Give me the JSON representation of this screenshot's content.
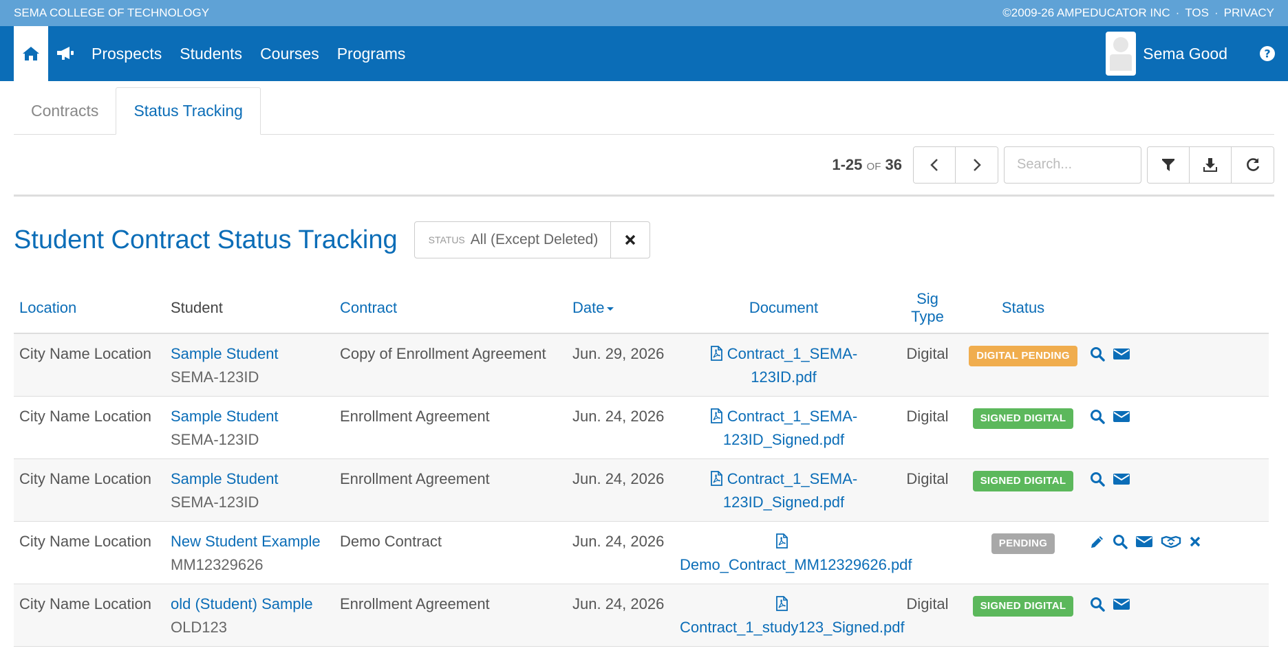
{
  "topbar": {
    "school": "SEMA COLLEGE OF TECHNOLOGY",
    "copyright": "©2009-26 AMPEDUCATOR INC",
    "tos": "TOS",
    "privacy": "PRIVACY",
    "sep": "·"
  },
  "nav": {
    "items": [
      {
        "label": "Prospects"
      },
      {
        "label": "Students"
      },
      {
        "label": "Courses"
      },
      {
        "label": "Programs"
      }
    ],
    "user_name": "Sema Good"
  },
  "tabs": [
    {
      "label": "Contracts",
      "active": false
    },
    {
      "label": "Status Tracking",
      "active": true
    }
  ],
  "toolbar": {
    "range": "1-25",
    "of": "of",
    "total": "36",
    "search_placeholder": "Search..."
  },
  "page": {
    "title": "Student Contract Status Tracking",
    "filter_label": "Status",
    "filter_value": "All (Except Deleted)"
  },
  "table": {
    "headers": {
      "location": "Location",
      "student": "Student",
      "contract": "Contract",
      "date": "Date",
      "document": "Document",
      "sig_type": "Sig Type",
      "status": "Status"
    },
    "rows": [
      {
        "location": "City Name Location",
        "student_name": "Sample Student",
        "student_id": "SEMA-123ID",
        "contract": "Copy of Enrollment Agreement",
        "date": "Jun. 29, 2026",
        "document": "Contract_1_SEMA-123ID.pdf",
        "sig_type": "Digital",
        "status": "DIGITAL PENDING",
        "status_color": "#f0ad4e",
        "actions": [
          "search",
          "envelope"
        ]
      },
      {
        "location": "City Name Location",
        "student_name": "Sample Student",
        "student_id": "SEMA-123ID",
        "contract": "Enrollment Agreement",
        "date": "Jun. 24, 2026",
        "document": "Contract_1_SEMA-123ID_Signed.pdf",
        "sig_type": "Digital",
        "status": "SIGNED DIGITAL",
        "status_color": "#5cb85c",
        "actions": [
          "search",
          "envelope"
        ]
      },
      {
        "location": "City Name Location",
        "student_name": "Sample Student",
        "student_id": "SEMA-123ID",
        "contract": "Enrollment Agreement",
        "date": "Jun. 24, 2026",
        "document": "Contract_1_SEMA-123ID_Signed.pdf",
        "sig_type": "Digital",
        "status": "SIGNED DIGITAL",
        "status_color": "#5cb85c",
        "actions": [
          "search",
          "envelope"
        ]
      },
      {
        "location": "City Name Location",
        "student_name": "New Student Example",
        "student_id": "MM12329626",
        "contract": "Demo Contract",
        "date": "Jun. 24, 2026",
        "document": "Demo_Contract_MM12329626.pdf",
        "sig_type": "",
        "status": "PENDING",
        "status_color": "#a8a8a8",
        "actions": [
          "pencil",
          "search",
          "envelope",
          "handshake",
          "times"
        ]
      },
      {
        "location": "City Name Location",
        "student_name": "old (Student) Sample",
        "student_id": "OLD123",
        "contract": "Enrollment Agreement",
        "date": "Jun. 24, 2026",
        "document": "Contract_1_study123_Signed.pdf",
        "sig_type": "Digital",
        "status": "SIGNED DIGITAL",
        "status_color": "#5cb85c",
        "actions": [
          "search",
          "envelope"
        ]
      }
    ]
  },
  "colors": {
    "primary": "#0b6db7",
    "topbar": "#5fa2d6"
  }
}
